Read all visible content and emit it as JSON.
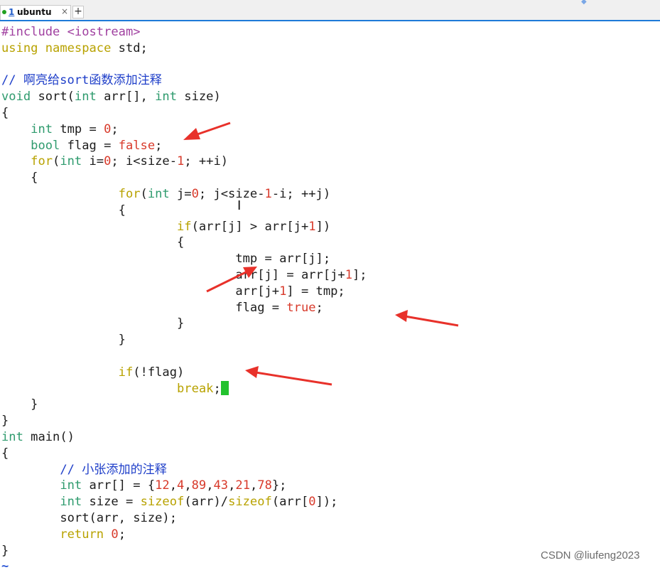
{
  "tab": {
    "number": "1",
    "title": "ubuntu",
    "close": "×",
    "add": "+"
  },
  "code": [
    [
      [
        "pp",
        "#include <iostream>"
      ]
    ],
    [
      [
        "kw",
        "using"
      ],
      [
        "tx",
        " "
      ],
      [
        "kw",
        "namespace"
      ],
      [
        "tx",
        " std;"
      ]
    ],
    [],
    [
      [
        "cm",
        "// 啊亮给sort函数添加注释"
      ]
    ],
    [
      [
        "ty",
        "void"
      ],
      [
        "tx",
        " sort("
      ],
      [
        "ty",
        "int"
      ],
      [
        "tx",
        " arr[], "
      ],
      [
        "ty",
        "int"
      ],
      [
        "tx",
        " size)"
      ]
    ],
    [
      [
        "tx",
        "{"
      ]
    ],
    [
      [
        "tx",
        "    "
      ],
      [
        "ty",
        "int"
      ],
      [
        "tx",
        " tmp = "
      ],
      [
        "nm",
        "0"
      ],
      [
        "tx",
        ";"
      ]
    ],
    [
      [
        "tx",
        "    "
      ],
      [
        "ty",
        "bool"
      ],
      [
        "tx",
        " flag = "
      ],
      [
        "st",
        "false"
      ],
      [
        "tx",
        ";"
      ]
    ],
    [
      [
        "tx",
        "    "
      ],
      [
        "kw",
        "for"
      ],
      [
        "tx",
        "("
      ],
      [
        "ty",
        "int"
      ],
      [
        "tx",
        " i="
      ],
      [
        "nm",
        "0"
      ],
      [
        "tx",
        "; i<size-"
      ],
      [
        "nm",
        "1"
      ],
      [
        "tx",
        "; ++i)"
      ]
    ],
    [
      [
        "tx",
        "    {"
      ]
    ],
    [
      [
        "tx",
        "                "
      ],
      [
        "kw",
        "for"
      ],
      [
        "tx",
        "("
      ],
      [
        "ty",
        "int"
      ],
      [
        "tx",
        " j="
      ],
      [
        "nm",
        "0"
      ],
      [
        "tx",
        "; j<size-"
      ],
      [
        "nm",
        "1"
      ],
      [
        "tx",
        "-i; ++j)"
      ]
    ],
    [
      [
        "tx",
        "                {"
      ]
    ],
    [
      [
        "tx",
        "                        "
      ],
      [
        "kw",
        "if"
      ],
      [
        "tx",
        "(arr[j] > arr[j+"
      ],
      [
        "nm",
        "1"
      ],
      [
        "tx",
        "])"
      ]
    ],
    [
      [
        "tx",
        "                        {"
      ]
    ],
    [
      [
        "tx",
        "                                tmp = arr[j];"
      ]
    ],
    [
      [
        "tx",
        "                                arr[j] = arr[j+"
      ],
      [
        "nm",
        "1"
      ],
      [
        "tx",
        "];"
      ]
    ],
    [
      [
        "tx",
        "                                arr[j+"
      ],
      [
        "nm",
        "1"
      ],
      [
        "tx",
        "] = tmp;"
      ]
    ],
    [
      [
        "tx",
        "                                flag = "
      ],
      [
        "st",
        "true"
      ],
      [
        "tx",
        ";"
      ]
    ],
    [
      [
        "tx",
        "                        }"
      ]
    ],
    [
      [
        "tx",
        "                }"
      ]
    ],
    [],
    [
      [
        "tx",
        "                "
      ],
      [
        "kw",
        "if"
      ],
      [
        "tx",
        "(!flag)"
      ]
    ],
    [
      [
        "tx",
        "                        "
      ],
      [
        "kw",
        "break"
      ],
      [
        "tx",
        ";"
      ],
      [
        "cursor",
        ""
      ]
    ],
    [
      [
        "tx",
        "    }"
      ]
    ],
    [
      [
        "tx",
        "}"
      ]
    ],
    [
      [
        "ty",
        "int"
      ],
      [
        "tx",
        " main()"
      ]
    ],
    [
      [
        "tx",
        "{"
      ]
    ],
    [
      [
        "tx",
        "        "
      ],
      [
        "cm",
        "// 小张添加的注释"
      ]
    ],
    [
      [
        "tx",
        "        "
      ],
      [
        "ty",
        "int"
      ],
      [
        "tx",
        " arr[] = {"
      ],
      [
        "nm",
        "12"
      ],
      [
        "tx",
        ","
      ],
      [
        "nm",
        "4"
      ],
      [
        "tx",
        ","
      ],
      [
        "nm",
        "89"
      ],
      [
        "tx",
        ","
      ],
      [
        "nm",
        "43"
      ],
      [
        "tx",
        ","
      ],
      [
        "nm",
        "21"
      ],
      [
        "tx",
        ","
      ],
      [
        "nm",
        "78"
      ],
      [
        "tx",
        "};"
      ]
    ],
    [
      [
        "tx",
        "        "
      ],
      [
        "ty",
        "int"
      ],
      [
        "tx",
        " size = "
      ],
      [
        "kw",
        "sizeof"
      ],
      [
        "tx",
        "(arr)/"
      ],
      [
        "kw",
        "sizeof"
      ],
      [
        "tx",
        "(arr["
      ],
      [
        "nm",
        "0"
      ],
      [
        "tx",
        "]);"
      ]
    ],
    [
      [
        "tx",
        "        sort(arr, size);"
      ]
    ],
    [
      [
        "tx",
        "        "
      ],
      [
        "kw",
        "return"
      ],
      [
        "tx",
        " "
      ],
      [
        "nm",
        "0"
      ],
      [
        "tx",
        ";"
      ]
    ],
    [
      [
        "tx",
        "}"
      ]
    ],
    [
      [
        "tilde",
        "~"
      ]
    ]
  ],
  "annotations": {
    "arrow_color": "#e8312a",
    "arrows": [
      "points-to-flag-false",
      "points-to-swap-block",
      "points-to-flag-true",
      "points-to-if-not-flag"
    ]
  },
  "watermark": "CSDN @liufeng2023"
}
